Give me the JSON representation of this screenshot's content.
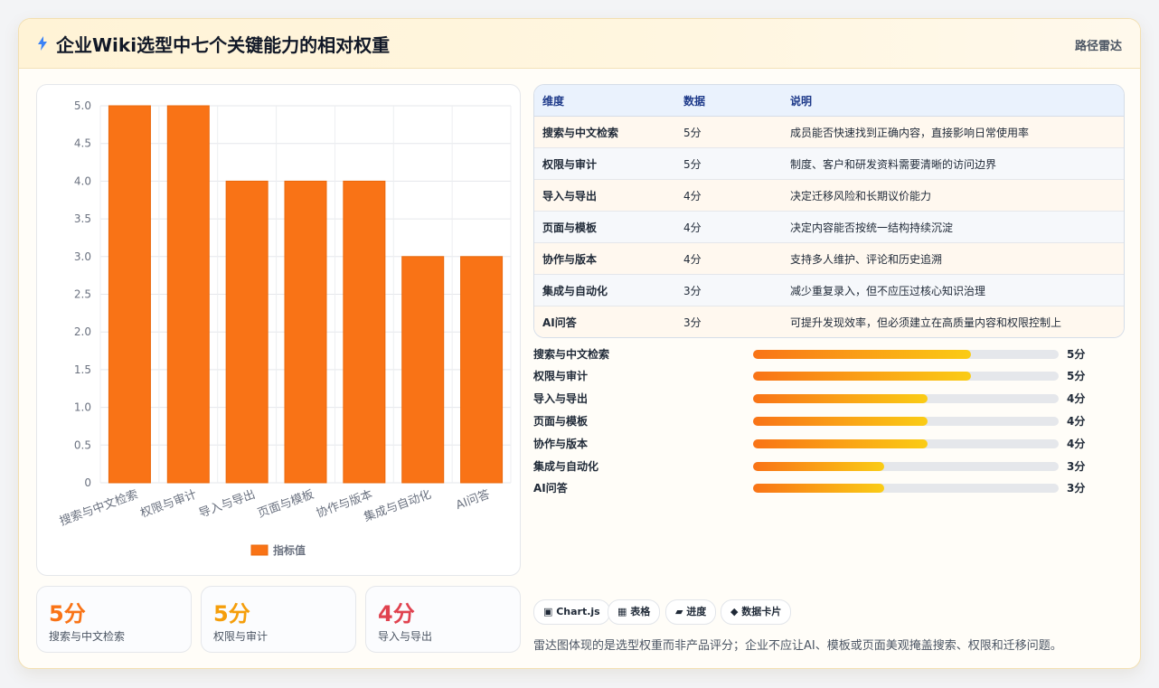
{
  "header": {
    "title": "企业Wiki选型中七个关键能力的相对权重",
    "badge": "路径雷达",
    "icon": "lightning-bolt-icon"
  },
  "chart_data": {
    "type": "bar",
    "categories": [
      "搜索与中文检索",
      "权限与审计",
      "导入与导出",
      "页面与模板",
      "协作与版本",
      "集成与自动化",
      "AI问答"
    ],
    "series": [
      {
        "name": "指标值",
        "values": [
          5,
          5,
          4,
          4,
          4,
          3,
          3
        ]
      }
    ],
    "ylim": [
      0,
      5
    ],
    "yticks": [
      "0",
      "0.5",
      "1.0",
      "1.5",
      "2.0",
      "2.5",
      "3.0",
      "3.5",
      "4.0",
      "4.5",
      "5.0"
    ],
    "grid": true,
    "legend": "bottom",
    "color": "#f97316"
  },
  "stats": [
    {
      "value": "5分",
      "label": "搜索与中文检索",
      "color": "#f97316"
    },
    {
      "value": "5分",
      "label": "权限与审计",
      "color": "#f59e0b"
    },
    {
      "value": "4分",
      "label": "导入与导出",
      "color": "#e0424f"
    }
  ],
  "table": {
    "headers": [
      "维度",
      "数据",
      "说明"
    ],
    "rows": [
      [
        "搜索与中文检索",
        "5分",
        "成员能否快速找到正确内容，直接影响日常使用率"
      ],
      [
        "权限与审计",
        "5分",
        "制度、客户和研发资料需要清晰的访问边界"
      ],
      [
        "导入与导出",
        "4分",
        "决定迁移风险和长期议价能力"
      ],
      [
        "页面与模板",
        "4分",
        "决定内容能否按统一结构持续沉淀"
      ],
      [
        "协作与版本",
        "4分",
        "支持多人维护、评论和历史追溯"
      ],
      [
        "集成与自动化",
        "3分",
        "减少重复录入，但不应压过核心知识治理"
      ],
      [
        "AI问答",
        "3分",
        "可提升发现效率，但必须建立在高质量内容和权限控制上"
      ]
    ]
  },
  "progress": [
    {
      "label": "搜索与中文检索",
      "value": "5分",
      "fraction": 0.714
    },
    {
      "label": "权限与审计",
      "value": "5分",
      "fraction": 0.714
    },
    {
      "label": "导入与导出",
      "value": "4分",
      "fraction": 0.571
    },
    {
      "label": "页面与模板",
      "value": "4分",
      "fraction": 0.571
    },
    {
      "label": "协作与版本",
      "value": "4分",
      "fraction": 0.571
    },
    {
      "label": "集成与自动化",
      "value": "3分",
      "fraction": 0.429
    },
    {
      "label": "AI问答",
      "value": "3分",
      "fraction": 0.429
    }
  ],
  "chips": [
    "▣ Chart.js",
    "▦ 表格",
    "▰ 进度",
    "◆ 数据卡片"
  ],
  "note": "雷达图体现的是选型权重而非产品评分；企业不应让AI、模板或页面美观掩盖搜索、权限和迁移问题。"
}
